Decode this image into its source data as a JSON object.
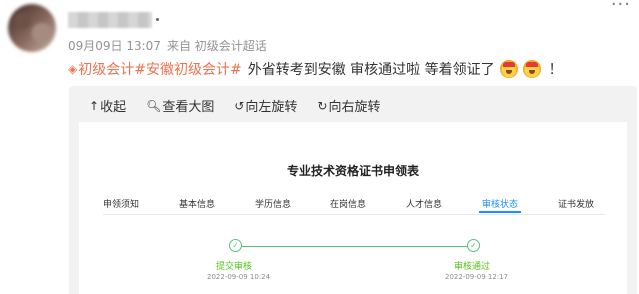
{
  "header": {
    "more_label": "···",
    "date": "09月09日 13:07",
    "source": "来自 初级会计超话"
  },
  "post": {
    "tags": [
      "初级会计",
      "#安徽初级会计#"
    ],
    "text": "外省转考到安徽 审核通过啦 等着领证了",
    "emojis": [
      "crown-emoji",
      "crown-emoji"
    ],
    "tail": "！"
  },
  "toolbar": {
    "collapse": "收起",
    "view_large": "查看大图",
    "rotate_left": "向左旋转",
    "rotate_right": "向右旋转"
  },
  "document": {
    "title": "专业技术资格证书申领表",
    "steps": [
      "申领须知",
      "基本信息",
      "学历信息",
      "在岗信息",
      "人才信息",
      "审核状态",
      "证书发放"
    ],
    "active_step": 5,
    "progress": [
      {
        "label": "提交审核",
        "time": "2022-09-09 10:24"
      },
      {
        "label": "审核通过",
        "time": "2022-09-09 12:17"
      }
    ],
    "accent_color": "#1890ff",
    "success_color": "#52c41a"
  }
}
